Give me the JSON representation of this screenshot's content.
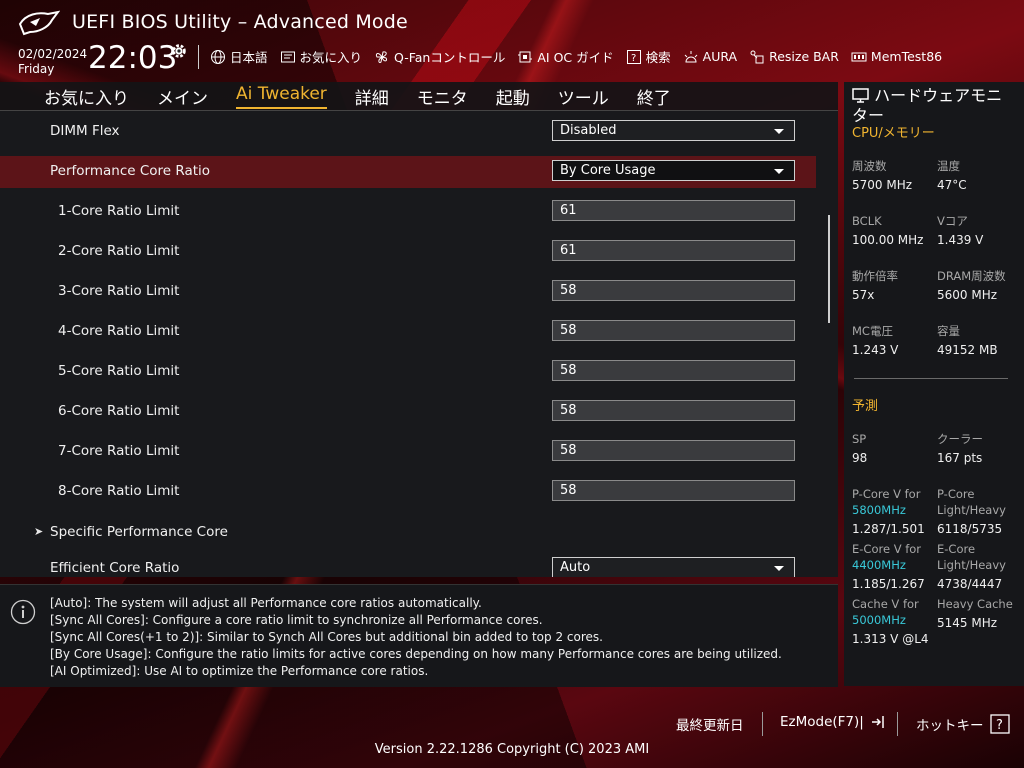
{
  "header": {
    "title": "UEFI BIOS Utility – Advanced Mode",
    "date": "02/02/2024",
    "day": "Friday",
    "time": "22:03",
    "tools": [
      {
        "label": "日本語",
        "icon": "globe-icon"
      },
      {
        "label": "お気に入り",
        "icon": "favorites-icon"
      },
      {
        "label": "Q-Fanコントロール",
        "icon": "fan-icon"
      },
      {
        "label": "AI OC ガイド",
        "icon": "ai-oc-icon"
      },
      {
        "label": "検索",
        "icon": "help-search-icon"
      },
      {
        "label": "AURA",
        "icon": "aura-icon"
      },
      {
        "label": "Resize BAR",
        "icon": "resize-bar-icon"
      },
      {
        "label": "MemTest86",
        "icon": "memtest-icon"
      }
    ]
  },
  "tabs": [
    "お気に入り",
    "メイン",
    "Ai Tweaker",
    "詳細",
    "モニタ",
    "起動",
    "ツール",
    "終了"
  ],
  "active_tab": "Ai Tweaker",
  "settings": [
    {
      "label": "DIMM Flex",
      "value": "Disabled"
    },
    {
      "label": "Performance Core Ratio",
      "value": "By Core Usage"
    },
    {
      "label": "1-Core Ratio Limit",
      "value": "61"
    },
    {
      "label": "2-Core Ratio Limit",
      "value": "61"
    },
    {
      "label": "3-Core Ratio Limit",
      "value": "58"
    },
    {
      "label": "4-Core Ratio Limit",
      "value": "58"
    },
    {
      "label": "5-Core Ratio Limit",
      "value": "58"
    },
    {
      "label": "6-Core Ratio Limit",
      "value": "58"
    },
    {
      "label": "7-Core Ratio Limit",
      "value": "58"
    },
    {
      "label": "8-Core Ratio Limit",
      "value": "58"
    },
    {
      "label": "Specific Performance Core"
    },
    {
      "label": "Efficient Core Ratio",
      "value": "Auto"
    }
  ],
  "help": [
    "[Auto]: The system will adjust all Performance core ratios automatically.",
    "[Sync All Cores]: Configure a core ratio limit to synchronize all Performance cores.",
    "[Sync All Cores(+1 to 2)]: Similar to Synch All Cores but additional bin added to top 2 cores.",
    "[By Core Usage]: Configure the ratio limits for active cores depending on how many Performance cores are being utilized.",
    "[AI Optimized]: Use AI to optimize the Performance core ratios."
  ],
  "monitor": {
    "title": "ハードウェアモニター",
    "cpu_section": "CPU/メモリー",
    "freq_label": "周波数",
    "freq": "5700 MHz",
    "temp_label": "温度",
    "temp": "47°C",
    "bclk_label": "BCLK",
    "bclk": "100.00 MHz",
    "vcore_label": "Vコア",
    "vcore": "1.439 V",
    "ratio_label": "動作倍率",
    "ratio": "57x",
    "dram_label": "DRAM周波数",
    "dram": "5600 MHz",
    "mc_label": "MC電圧",
    "mc": "1.243 V",
    "cap_label": "容量",
    "cap": "49152 MB",
    "predict_section": "予測",
    "sp_label": "SP",
    "sp": "98",
    "cooler_label": "クーラー",
    "cooler": "167 pts",
    "pcore_v_label": "P-Core V for",
    "pcore_v_freq": "5800MHz",
    "pcore_v": "1.287/1.501",
    "pcore_lh_label": "P-Core Light/Heavy",
    "pcore_lh": "6118/5735",
    "ecore_v_label": "E-Core V for",
    "ecore_v_freq": "4400MHz",
    "ecore_v": "1.185/1.267",
    "ecore_lh_label": "E-Core Light/Heavy",
    "ecore_lh": "4738/4447",
    "cache_v_label": "Cache V for",
    "cache_v_freq": "5000MHz",
    "cache_v": "1.313 V @L4",
    "heavy_cache_label": "Heavy Cache",
    "heavy_cache": "5145 MHz"
  },
  "footer": {
    "last_modified": "最終更新日",
    "ezmode": "EzMode(F7)|",
    "hotkeys": "ホットキー",
    "version": "Version 2.22.1286 Copyright (C) 2023 AMI"
  },
  "colors": {
    "accent": "#f0b430",
    "selected_row": "#5c1418",
    "cyan": "#39c8d8"
  }
}
